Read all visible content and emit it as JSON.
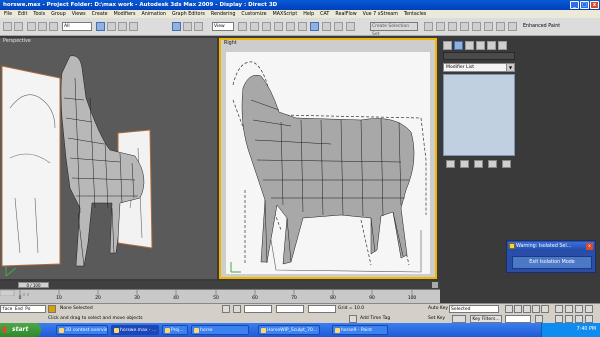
{
  "titlebar": {
    "title": "horswe.max    -  Project Folder: D:\\max work        -  Autodesk 3ds Max  2009        -  Display : Direct 3D",
    "min": "_",
    "max": "□",
    "close": "x"
  },
  "menu": [
    "File",
    "Edit",
    "Tools",
    "Group",
    "Views",
    "Create",
    "Modifiers",
    "Animation",
    "Graph Editors",
    "Rendering",
    "Customize",
    "MAXScript",
    "Help",
    "CAT",
    "RealFlow",
    "Vue 7 xStream",
    "Tentacles"
  ],
  "toolbar": {
    "selection_filter": "All",
    "ref_coord": "View",
    "named_selection": "Create Selection Set",
    "enhanced_paint": "Enhanced Paint"
  },
  "viewports": {
    "left_label": "Perspective",
    "right_label": "Right"
  },
  "command_panel": {
    "modifier_list": "Modifier List",
    "arrow": "▼"
  },
  "warning": {
    "title": "Warning: Isolated Sel...",
    "close": "x",
    "button": "Exit Isolation Mode"
  },
  "timeslider": {
    "handle": "0 / 100",
    "arrow": ">"
  },
  "track": {
    "ticks": [
      "0",
      "10",
      "20",
      "30",
      "40",
      "50",
      "60",
      "70",
      "80",
      "90",
      "100"
    ]
  },
  "status": {
    "maxscript_prompt": "face End Po",
    "selection": "None Selected",
    "prompt": "Click and drag to select and move objects",
    "grid": "Grid = 10.0",
    "add_time_tag": "Add Time Tag",
    "auto_key": "Auto Key",
    "auto_key_mode": "Selected",
    "set_key": "Set Key",
    "key_filters": "Key Filters..."
  },
  "taskbar": {
    "start": "start",
    "tasks": [
      "3D contest overview ...",
      "horswe.max - ...",
      "Proj...",
      "horse",
      "HorseWIP_Sculpt_70...",
      "horse9 - Paint"
    ],
    "clock": "7:40 PM"
  },
  "colors": {
    "active_viewport_border": "#f2b500",
    "title_blue": "#0a5ad8",
    "warning_blue": "#2a4ea8"
  }
}
